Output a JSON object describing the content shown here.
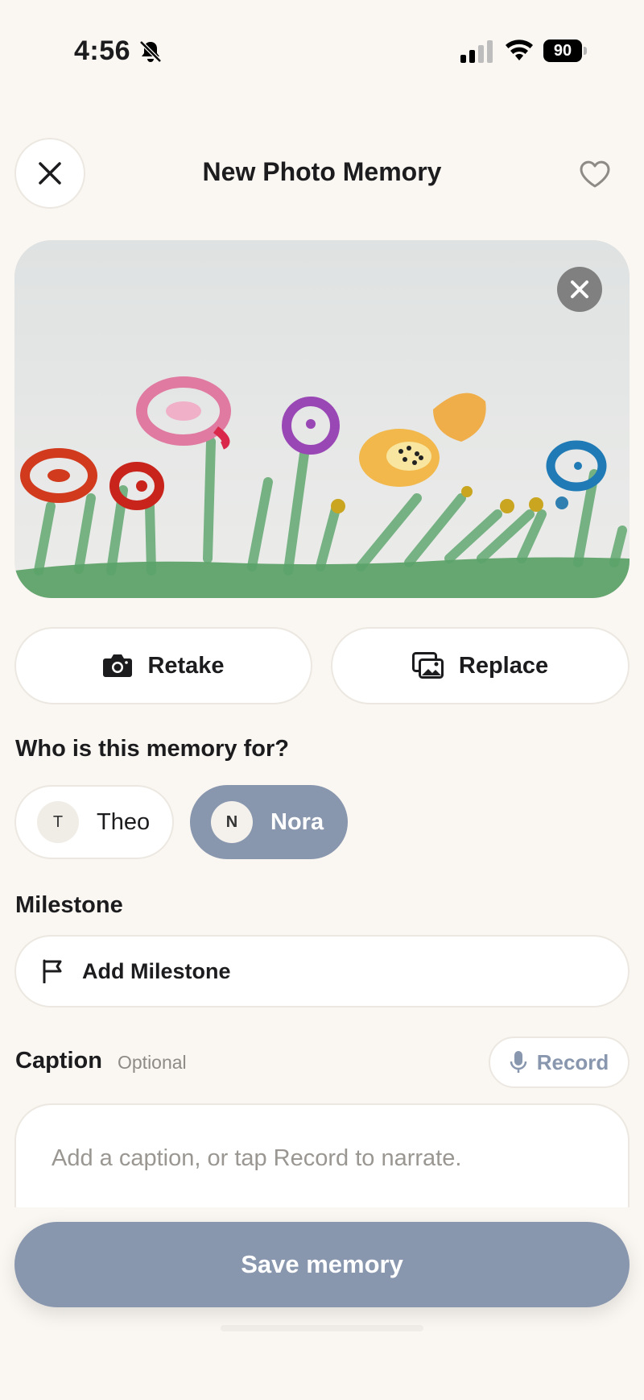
{
  "status_bar": {
    "time": "4:56",
    "battery": "90"
  },
  "header": {
    "title": "New Photo Memory"
  },
  "photo": {
    "description_icon": "child-flower-painting"
  },
  "actions": {
    "retake_label": "Retake",
    "replace_label": "Replace"
  },
  "who": {
    "label": "Who is this memory for?",
    "children": [
      {
        "initial": "T",
        "name": "Theo",
        "selected": false
      },
      {
        "initial": "N",
        "name": "Nora",
        "selected": true
      }
    ]
  },
  "milestone": {
    "label": "Milestone",
    "button_label": "Add Milestone"
  },
  "caption": {
    "label": "Caption",
    "optional": "Optional",
    "record_label": "Record",
    "placeholder": "Add a caption, or tap Record to narrate.",
    "value": ""
  },
  "save_label": "Save memory",
  "colors": {
    "accent": "#8896ae",
    "background": "#faf7f2"
  }
}
